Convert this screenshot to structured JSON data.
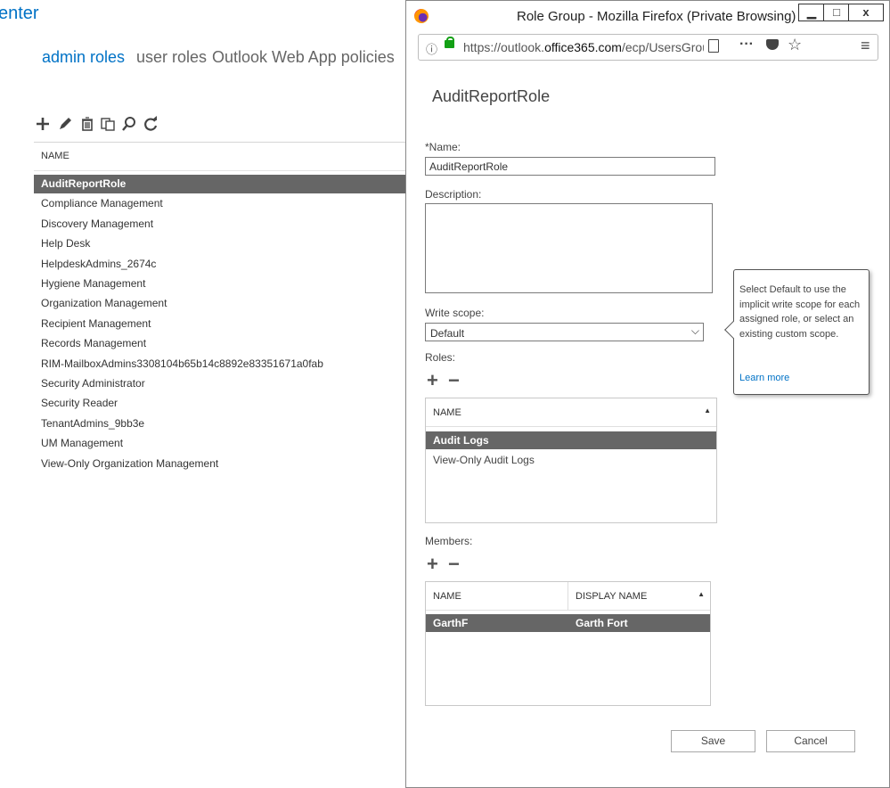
{
  "app": {
    "title": "enter"
  },
  "subnav": {
    "items": [
      "admin roles",
      "user roles",
      "Outlook Web App policies"
    ],
    "active_color": "#0072c6"
  },
  "toolbar": {
    "icons": [
      "add-icon",
      "edit-icon",
      "delete-icon",
      "copy-icon",
      "search-icon",
      "refresh-icon"
    ]
  },
  "role_list": {
    "column_header": "NAME",
    "rows": [
      "AuditReportRole",
      "Compliance Management",
      "Discovery Management",
      "Help Desk",
      "HelpdeskAdmins_2674c",
      "Hygiene Management",
      "Organization Management",
      "Recipient Management",
      "Records Management",
      "RIM-MailboxAdmins3308104b65b14c8892e83351671a0fab",
      "Security Administrator",
      "Security Reader",
      "TenantAdmins_9bb3e",
      "UM Management",
      "View-Only Organization Management"
    ],
    "selected": "AuditReportRole"
  },
  "browser": {
    "window_title": "Role Group - Mozilla Firefox (Private Browsing)",
    "url_prefix": "https://outlook.",
    "url_domain": "office365.com",
    "url_suffix": "/ecp/UsersGroups/Edi",
    "window_buttons": {
      "minimize": "▁",
      "maximize": "□",
      "close": "x"
    }
  },
  "dialog": {
    "title": "AuditReportRole",
    "name_label": "*Name:",
    "name_value": "AuditReportRole",
    "description_label": "Description:",
    "description_value": "",
    "write_scope_label": "Write scope:",
    "write_scope_value": "Default",
    "roles_label": "Roles:",
    "roles_grid": {
      "column": "NAME",
      "rows": [
        "Audit Logs",
        "View-Only Audit Logs"
      ],
      "selected": "Audit Logs"
    },
    "members_label": "Members:",
    "members_grid": {
      "columns": [
        "NAME",
        "DISPLAY NAME"
      ],
      "rows": [
        {
          "name": "GarthF",
          "display_name": "Garth Fort"
        }
      ]
    },
    "callout": {
      "text": "Select Default to use the implicit write scope for each assigned role, or select an existing custom scope.",
      "link": "Learn more"
    },
    "save_label": "Save",
    "cancel_label": "Cancel"
  }
}
